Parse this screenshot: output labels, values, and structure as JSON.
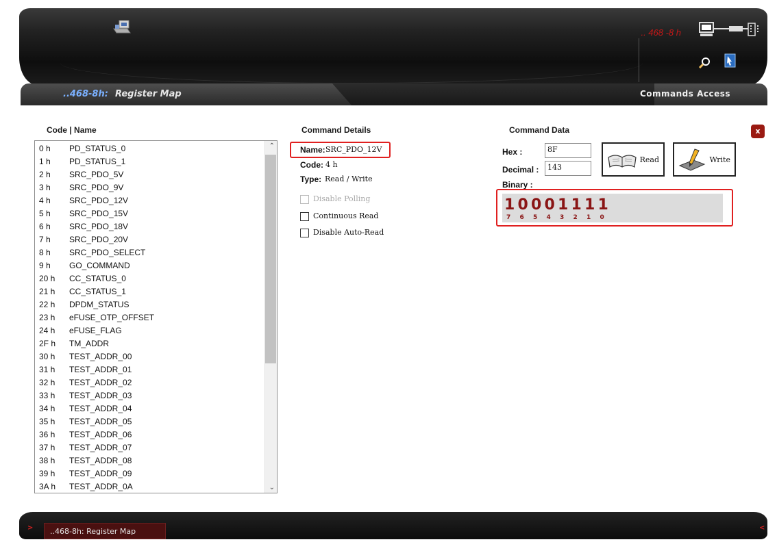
{
  "header": {
    "device_address": ".. 468 -8 h"
  },
  "titlebar": {
    "prefix": "..468-8h:",
    "title": "Register Map",
    "right_label": "Commands Access"
  },
  "register_list": {
    "header": "Code | Name",
    "rows": [
      {
        "code": "0 h",
        "name": "PD_STATUS_0"
      },
      {
        "code": "1 h",
        "name": "PD_STATUS_1"
      },
      {
        "code": "2 h",
        "name": "SRC_PDO_5V"
      },
      {
        "code": "3 h",
        "name": "SRC_PDO_9V"
      },
      {
        "code": "4 h",
        "name": "SRC_PDO_12V"
      },
      {
        "code": "5 h",
        "name": "SRC_PDO_15V"
      },
      {
        "code": "6 h",
        "name": "SRC_PDO_18V"
      },
      {
        "code": "7 h",
        "name": "SRC_PDO_20V"
      },
      {
        "code": "8 h",
        "name": "SRC_PDO_SELECT"
      },
      {
        "code": "9 h",
        "name": "GO_COMMAND"
      },
      {
        "code": "20 h",
        "name": "CC_STATUS_0"
      },
      {
        "code": "21 h",
        "name": "CC_STATUS_1"
      },
      {
        "code": "22 h",
        "name": "DPDM_STATUS"
      },
      {
        "code": "23 h",
        "name": "eFUSE_OTP_OFFSET"
      },
      {
        "code": "24 h",
        "name": "eFUSE_FLAG"
      },
      {
        "code": "2F h",
        "name": "TM_ADDR"
      },
      {
        "code": "30 h",
        "name": "TEST_ADDR_00"
      },
      {
        "code": "31 h",
        "name": "TEST_ADDR_01"
      },
      {
        "code": "32 h",
        "name": "TEST_ADDR_02"
      },
      {
        "code": "33 h",
        "name": "TEST_ADDR_03"
      },
      {
        "code": "34 h",
        "name": "TEST_ADDR_04"
      },
      {
        "code": "35 h",
        "name": "TEST_ADDR_05"
      },
      {
        "code": "36 h",
        "name": "TEST_ADDR_06"
      },
      {
        "code": "37 h",
        "name": "TEST_ADDR_07"
      },
      {
        "code": "38 h",
        "name": "TEST_ADDR_08"
      },
      {
        "code": "39 h",
        "name": "TEST_ADDR_09"
      },
      {
        "code": "3A h",
        "name": "TEST_ADDR_0A"
      }
    ]
  },
  "command_details": {
    "header": "Command Details",
    "name_label": "Name:",
    "name_value": "SRC_PDO_12V",
    "code_label": "Code:",
    "code_value": "4 h",
    "type_label": "Type:",
    "type_value": "Read / Write",
    "disable_polling": "Disable Polling",
    "continuous_read": "Continuous Read",
    "disable_auto_read": "Disable Auto-Read"
  },
  "command_data": {
    "header": "Command Data",
    "hex_label": "Hex :",
    "hex_value": "8F",
    "decimal_label": "Decimal :",
    "decimal_value": "143",
    "binary_label": "Binary :",
    "read_label": "Read",
    "write_label": "Write",
    "bits": [
      "1",
      "0",
      "0",
      "0",
      "1",
      "1",
      "1",
      "1"
    ],
    "bit_indices": [
      "7",
      "6",
      "5",
      "4",
      "3",
      "2",
      "1",
      "0"
    ]
  },
  "close_label": "x",
  "taskbar": {
    "left_nav": ">",
    "right_nav": "<",
    "tab_label": "..468-8h: Register Map"
  },
  "colors": {
    "highlight": "#e02020",
    "accent_red": "#c41818",
    "title_blue": "#7ab0ff",
    "bit_color": "#8a1515"
  }
}
